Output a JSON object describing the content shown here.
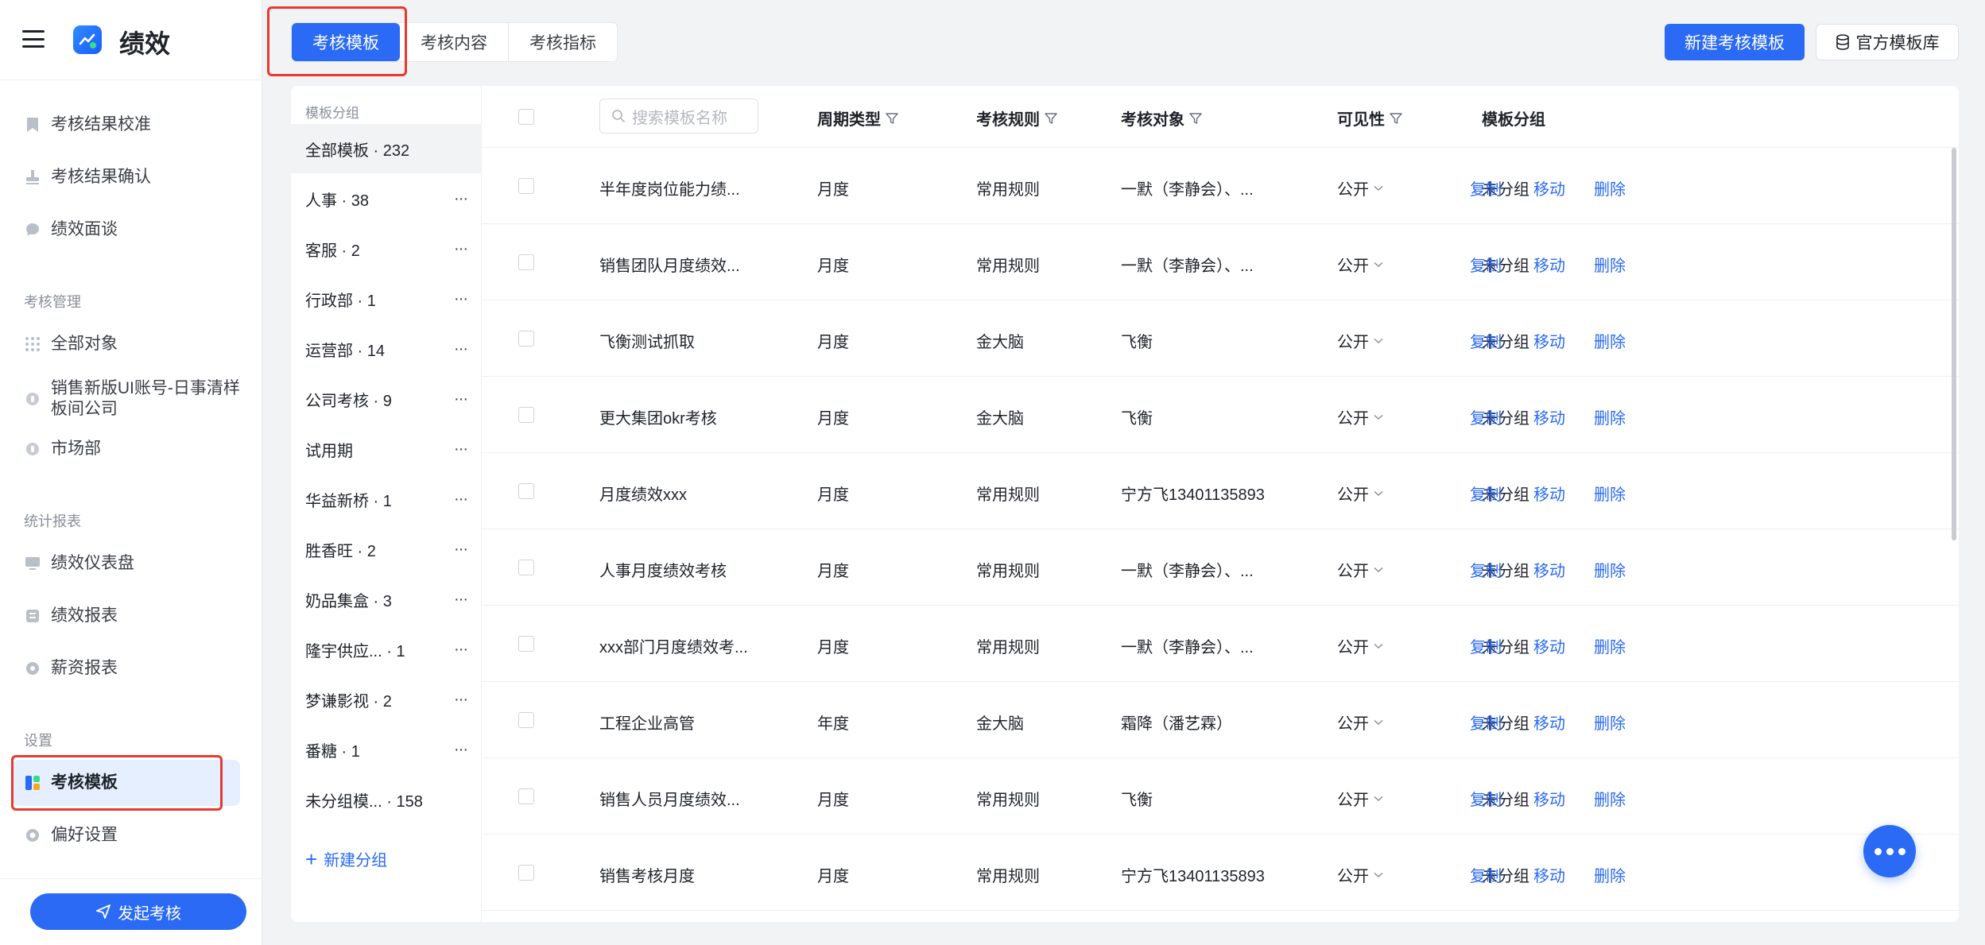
{
  "app": {
    "title": "绩效"
  },
  "sidebar": {
    "items_top": [
      {
        "label": "考核结果校准",
        "icon": "bookmark-icon"
      },
      {
        "label": "考核结果确认",
        "icon": "stamp-icon"
      },
      {
        "label": "绩效面谈",
        "icon": "chat-icon"
      }
    ],
    "sections": [
      {
        "title": "考核管理",
        "items": [
          {
            "label": "全部对象",
            "icon": "grid-icon"
          },
          {
            "label": "销售新版UI账号-日事清样板间公司",
            "icon": "org-icon"
          },
          {
            "label": "市场部",
            "icon": "org-icon"
          }
        ]
      },
      {
        "title": "统计报表",
        "items": [
          {
            "label": "绩效仪表盘",
            "icon": "dashboard-icon"
          },
          {
            "label": "绩效报表",
            "icon": "report-icon"
          },
          {
            "label": "薪资报表",
            "icon": "money-icon"
          }
        ]
      },
      {
        "title": "设置",
        "items": [
          {
            "label": "考核模板",
            "icon": "template-icon",
            "active": true
          },
          {
            "label": "偏好设置",
            "icon": "settings-icon"
          }
        ]
      }
    ],
    "start_button": "发起考核"
  },
  "tabs": [
    {
      "label": "考核模板",
      "active": true
    },
    {
      "label": "考核内容"
    },
    {
      "label": "考核指标"
    }
  ],
  "header_buttons": {
    "new_template": "新建考核模板",
    "official_library": "官方模板库"
  },
  "groups": {
    "title": "模板分组",
    "items": [
      {
        "label": "全部模板 · 232",
        "active": true,
        "more": false
      },
      {
        "label": "人事 · 38",
        "more": true
      },
      {
        "label": "客服 · 2",
        "more": true
      },
      {
        "label": "行政部 · 1",
        "more": true
      },
      {
        "label": "运营部 · 14",
        "more": true
      },
      {
        "label": "公司考核 · 9",
        "more": true
      },
      {
        "label": "试用期",
        "more": true
      },
      {
        "label": "华益新桥 · 1",
        "more": true
      },
      {
        "label": "胜香旺 · 2",
        "more": true
      },
      {
        "label": "奶品集盒 · 3",
        "more": true
      },
      {
        "label": "隆宇供应... · 1",
        "more": true
      },
      {
        "label": "梦谦影视 · 2",
        "more": true
      },
      {
        "label": "番糖 · 1",
        "more": true
      },
      {
        "label": "未分组模... · 158",
        "more": false
      }
    ],
    "new_group": "新建分组",
    "more_glyph": "···"
  },
  "table": {
    "search_placeholder": "搜索模板名称",
    "columns": {
      "period": "周期类型",
      "rule": "考核规则",
      "target": "考核对象",
      "visibility": "可见性",
      "group": "模板分组"
    },
    "actions": {
      "copy": "复制",
      "move": "移动",
      "delete": "删除"
    },
    "rows": [
      {
        "name": "半年度岗位能力绩...",
        "period": "月度",
        "rule": "常用规则",
        "target": "一默（李静会）、...",
        "visibility": "公开",
        "group": "未分组"
      },
      {
        "name": "销售团队月度绩效...",
        "period": "月度",
        "rule": "常用规则",
        "target": "一默（李静会）、...",
        "visibility": "公开",
        "group": "未分组"
      },
      {
        "name": "飞衡测试抓取",
        "period": "月度",
        "rule": "金大脑",
        "target": "飞衡",
        "visibility": "公开",
        "group": "未分组"
      },
      {
        "name": "更大集团okr考核",
        "period": "月度",
        "rule": "金大脑",
        "target": "飞衡",
        "visibility": "公开",
        "group": "未分组"
      },
      {
        "name": "月度绩效xxx",
        "period": "月度",
        "rule": "常用规则",
        "target": "宁方飞13401135893",
        "visibility": "公开",
        "group": "未分组"
      },
      {
        "name": "人事月度绩效考核",
        "period": "月度",
        "rule": "常用规则",
        "target": "一默（李静会）、...",
        "visibility": "公开",
        "group": "未分组"
      },
      {
        "name": "xxx部门月度绩效考...",
        "period": "月度",
        "rule": "常用规则",
        "target": "一默（李静会）、...",
        "visibility": "公开",
        "group": "未分组"
      },
      {
        "name": "工程企业高管",
        "period": "年度",
        "rule": "金大脑",
        "target": "霜降（潘艺霖）",
        "visibility": "公开",
        "group": "未分组"
      },
      {
        "name": "销售人员月度绩效...",
        "period": "月度",
        "rule": "常用规则",
        "target": "飞衡",
        "visibility": "公开",
        "group": "未分组"
      },
      {
        "name": "销售考核月度",
        "period": "月度",
        "rule": "常用规则",
        "target": "宁方飞13401135893",
        "visibility": "公开",
        "group": "未分组"
      }
    ]
  },
  "colors": {
    "accent": "#2a6af5",
    "highlight": "#e8392f",
    "active_bg": "#e6efff"
  }
}
